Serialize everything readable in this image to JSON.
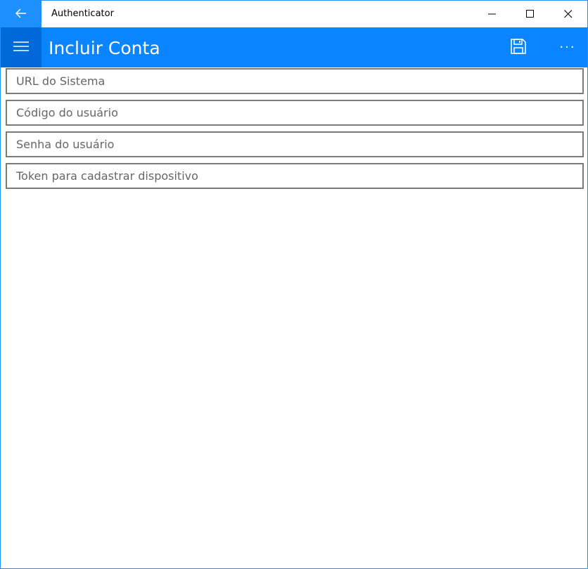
{
  "window": {
    "app_title": "Authenticator",
    "accent_color": "#1e90ff"
  },
  "titlebar": {
    "back_icon": "arrow-left-icon",
    "minimize_icon": "minimize-icon",
    "maximize_icon": "maximize-icon",
    "close_icon": "close-icon"
  },
  "appbar": {
    "title": "Incluir Conta",
    "background": "#0a84ff",
    "menu_icon": "hamburger-menu-icon",
    "save_icon": "save-icon",
    "more_label": "···"
  },
  "form": {
    "url": {
      "placeholder": "URL do Sistema",
      "value": ""
    },
    "user_code": {
      "placeholder": "Código do usuário",
      "value": ""
    },
    "password": {
      "placeholder": "Senha do usuário",
      "value": ""
    },
    "token": {
      "placeholder": "Token para cadastrar dispositivo",
      "value": ""
    }
  }
}
